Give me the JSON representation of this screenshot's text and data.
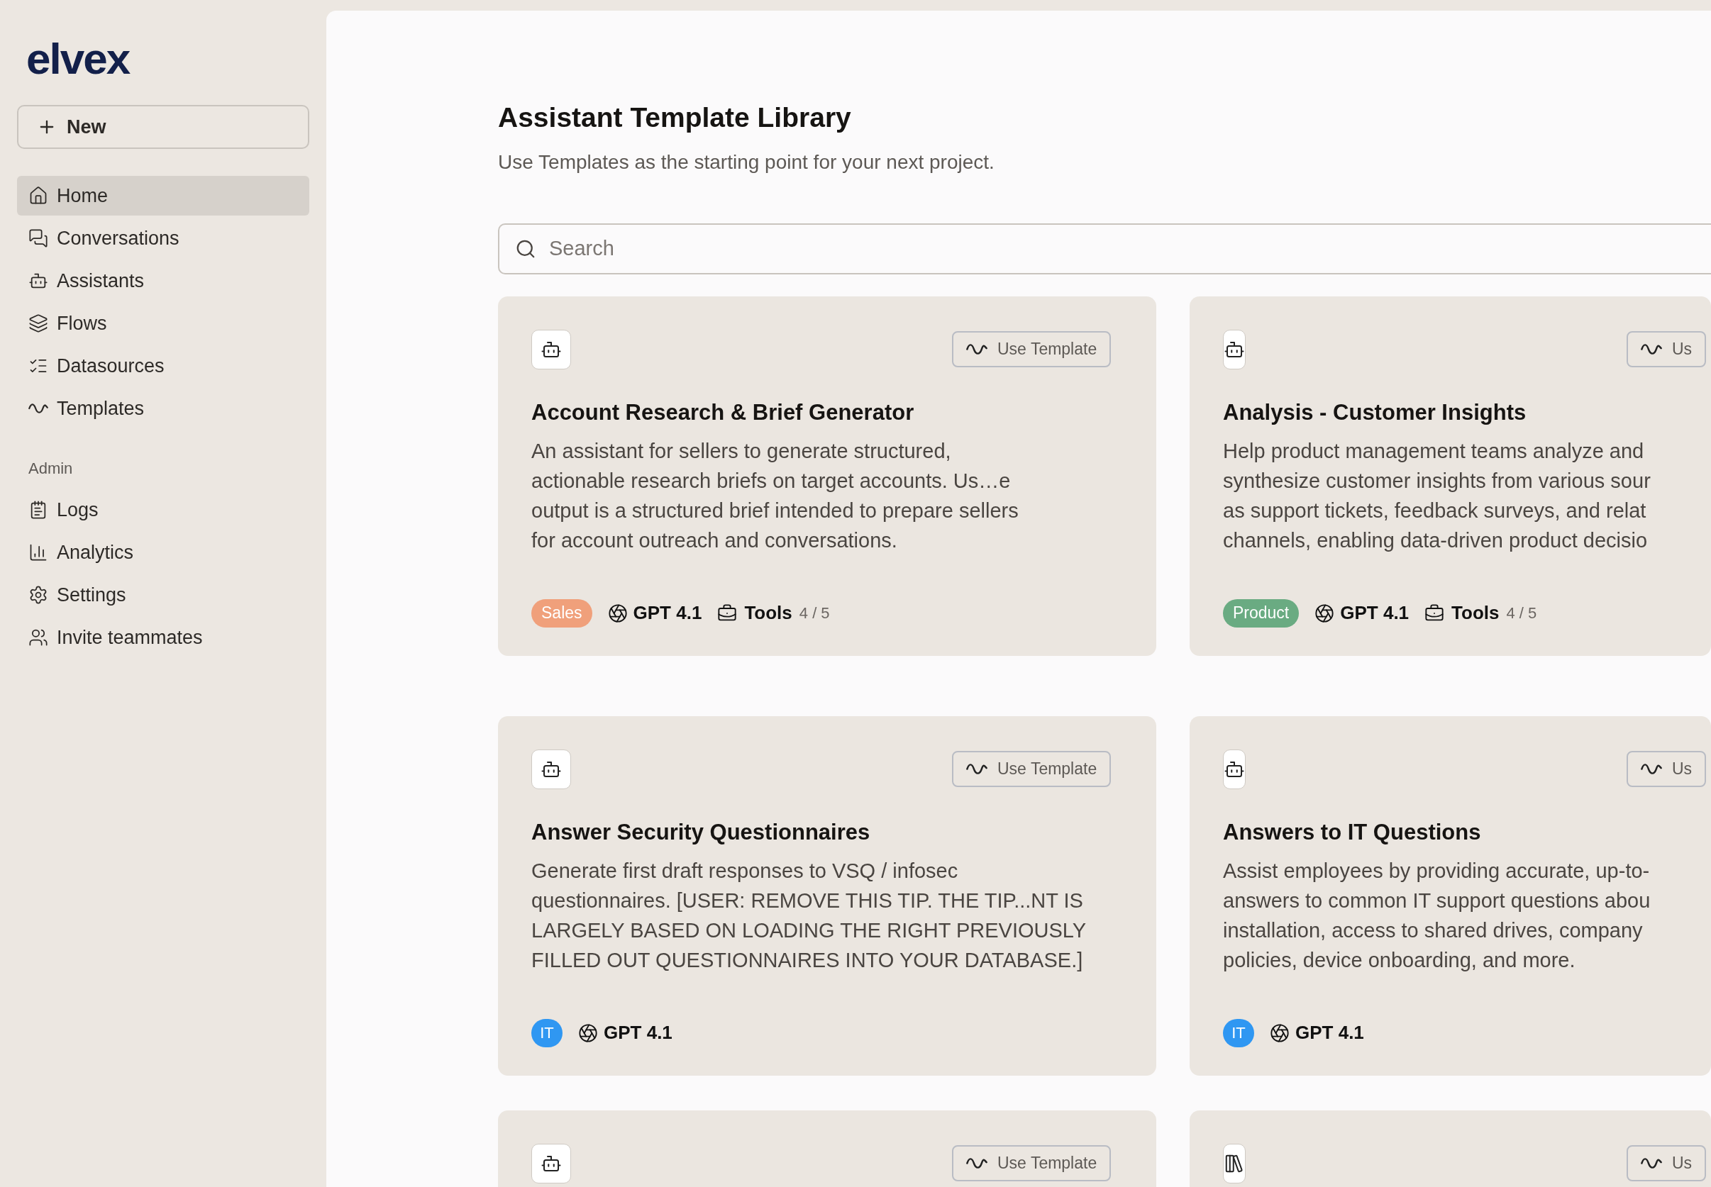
{
  "sidebar": {
    "logo": "elvex",
    "new_button": "New",
    "items": [
      {
        "label": "Home",
        "selected": true
      },
      {
        "label": "Conversations",
        "selected": false
      },
      {
        "label": "Assistants",
        "selected": false
      },
      {
        "label": "Flows",
        "selected": false
      },
      {
        "label": "Datasources",
        "selected": false
      },
      {
        "label": "Templates",
        "selected": false
      }
    ],
    "admin_heading": "Admin",
    "admin_items": [
      {
        "label": "Logs",
        "selected": false
      },
      {
        "label": "Analytics",
        "selected": false
      },
      {
        "label": "Settings",
        "selected": false
      },
      {
        "label": "Invite teammates",
        "selected": false
      }
    ]
  },
  "main": {
    "title": "Assistant Template Library",
    "subtitle": "Use Templates as the starting point for your next project.",
    "search": {
      "placeholder": "Search"
    },
    "cards": [
      {
        "kind": "bot",
        "button": "Use Template",
        "title": "Account Research & Brief Generator",
        "description": [
          "An assistant for sellers to generate structured,",
          "actionable research briefs on target accounts. Us…e",
          "output is a structured brief intended to prepare sellers",
          "for account outreach and conversations."
        ],
        "tag": {
          "label": "Sales",
          "color": "#f0a07b"
        },
        "model": "GPT 4.1",
        "tools": {
          "label": "Tools",
          "count": "4 / 5"
        }
      },
      {
        "kind": "bot",
        "button": "Us",
        "title": "Analysis - Customer Insights",
        "description": [
          "Help product management teams analyze and",
          "synthesize customer insights from various sour",
          "as support tickets, feedback surveys, and relat",
          "channels, enabling data-driven product decisio"
        ],
        "tag": {
          "label": "Product",
          "color": "#6aab82"
        },
        "model": "GPT 4.1",
        "tools": {
          "label": "Tools",
          "count": "4 / 5"
        }
      },
      {
        "kind": "bot",
        "button": "Use Template",
        "title": "Answer Security Questionnaires",
        "description": [
          "Generate first draft responses to VSQ / infosec",
          "questionnaires. [USER: REMOVE THIS TIP. THE TIP...NT IS",
          "LARGELY BASED ON LOADING THE RIGHT PREVIOUSLY",
          "FILLED OUT QUESTIONNAIRES INTO YOUR DATABASE.]"
        ],
        "tag": {
          "label": "IT",
          "color": "#2f97f2"
        },
        "model": "GPT 4.1"
      },
      {
        "kind": "bot",
        "button": "Us",
        "title": "Answers to IT Questions",
        "description": [
          "Assist employees by providing accurate, up-to-",
          "answers to common IT support questions abou",
          "installation, access to shared drives, company",
          "policies, device onboarding, and more."
        ],
        "tag": {
          "label": "IT",
          "color": "#2f97f2"
        },
        "model": "GPT 4.1"
      },
      {
        "kind": "bot",
        "button": "Use Template"
      },
      {
        "kind": "book",
        "button": "Us"
      }
    ]
  }
}
